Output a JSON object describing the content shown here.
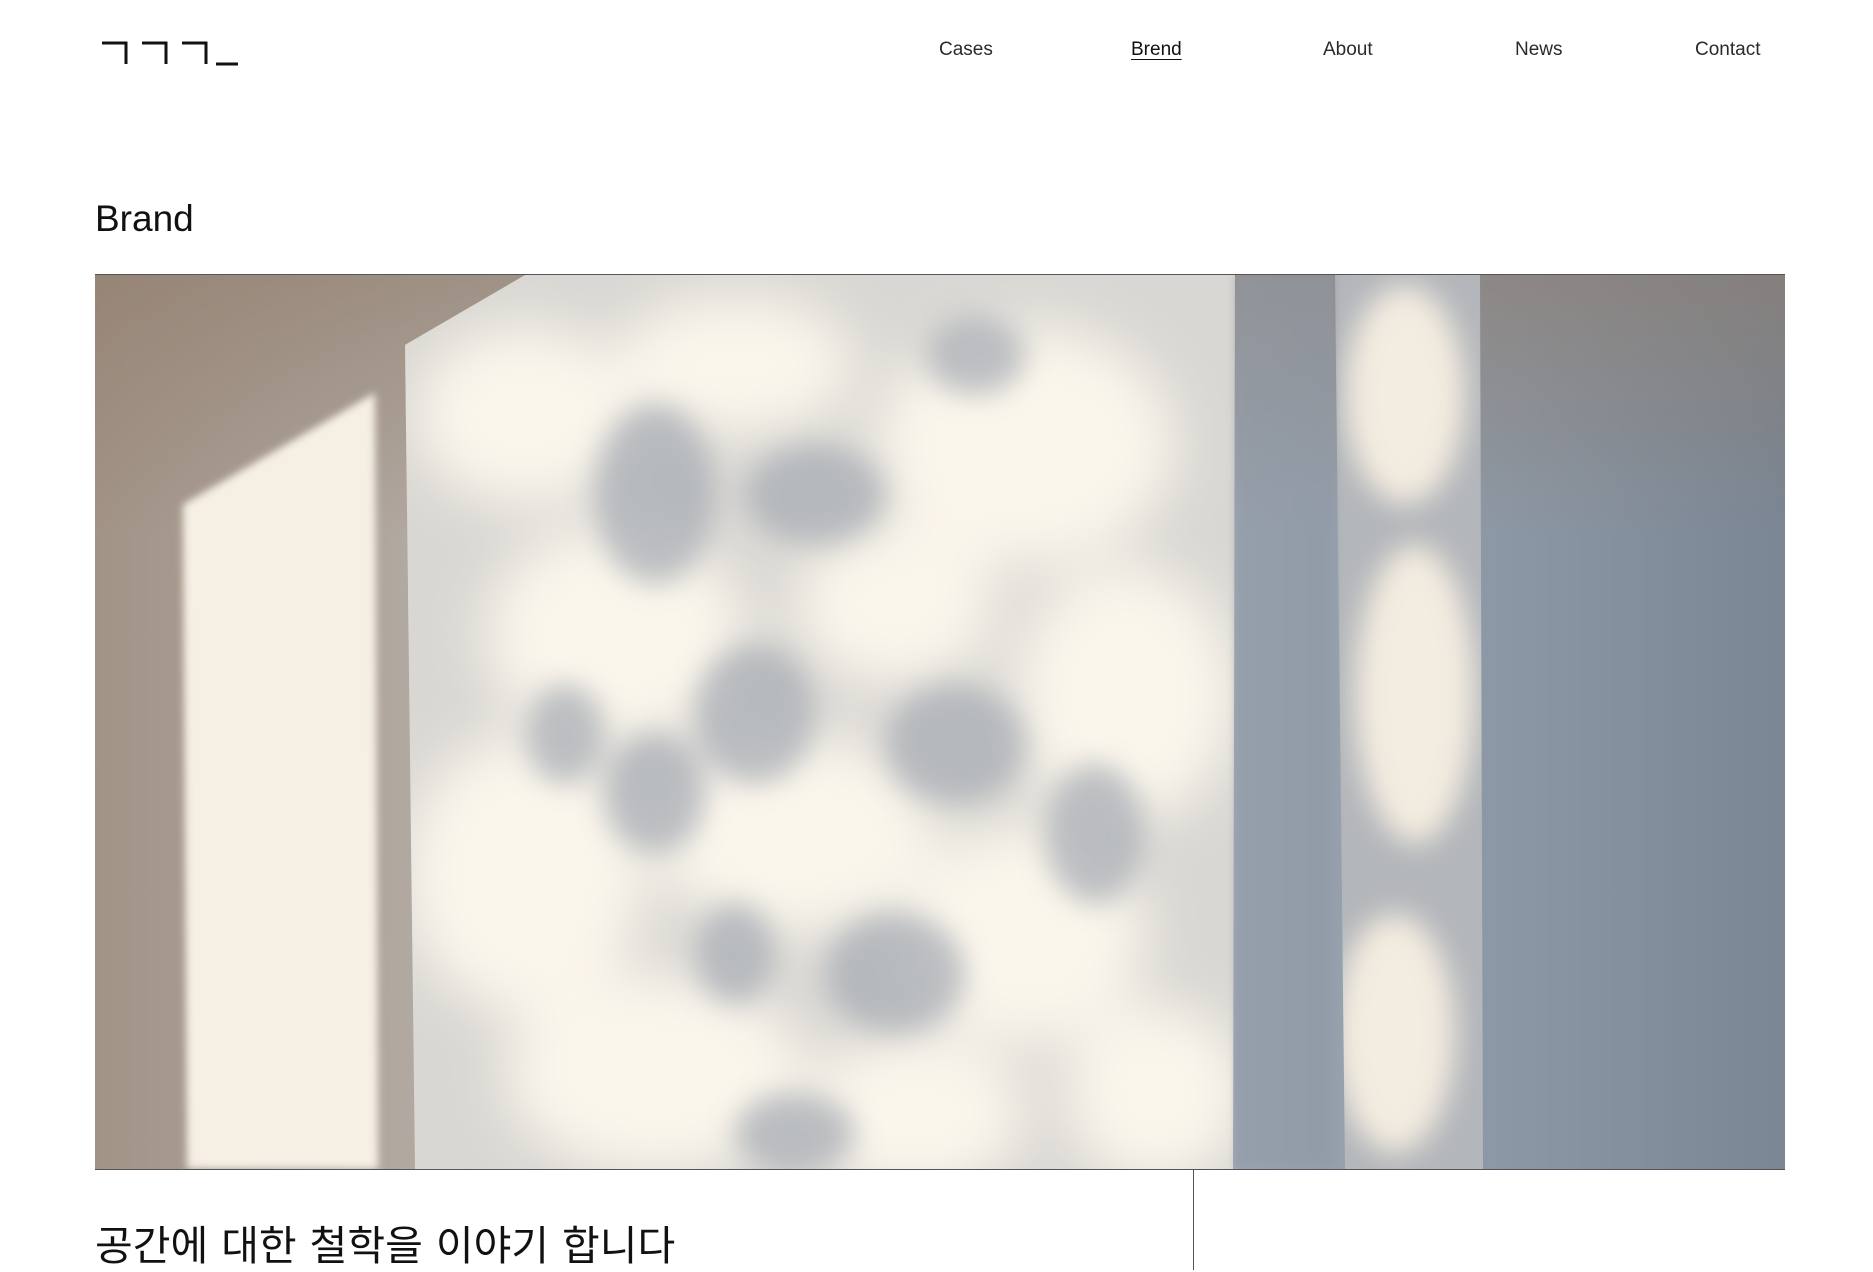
{
  "header": {
    "logo_alt": "ㄱㄱㄱ_",
    "nav": [
      {
        "label": "Cases",
        "active": false
      },
      {
        "label": "Brend",
        "active": true
      },
      {
        "label": "About",
        "active": false
      },
      {
        "label": "News",
        "active": false
      },
      {
        "label": "Contact",
        "active": false
      }
    ]
  },
  "page": {
    "title": "Brand",
    "hero_image": "sunlight-tree-shadows-on-wall",
    "headline": "공간에 대한 철학을 이야기 합니다"
  },
  "colors": {
    "background": "#ffffff",
    "text": "#111111",
    "rule": "#555555"
  }
}
